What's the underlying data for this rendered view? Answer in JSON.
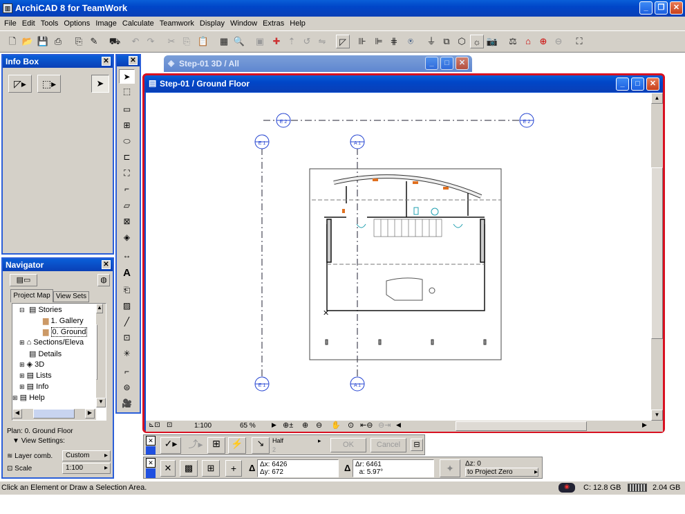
{
  "app": {
    "title": "ArchiCAD 8 for TeamWork"
  },
  "menu": [
    "File",
    "Edit",
    "Tools",
    "Options",
    "Image",
    "Calculate",
    "Teamwork",
    "Display",
    "Window",
    "Extras",
    "Help"
  ],
  "infobox": {
    "title": "Info Box"
  },
  "navigator": {
    "title": "Navigator",
    "tab_project": "Project Map",
    "tab_views": "View Sets",
    "tree": {
      "stories": "Stories",
      "gallery": "1. Gallery",
      "ground": "0. Ground",
      "sections": "Sections/Eleva",
      "details": "Details",
      "three_d": "3D",
      "lists": "Lists",
      "info": "Info",
      "help": "Help"
    },
    "plan": "Plan: 0. Ground Floor",
    "view_settings": "View Settings:",
    "layer_label": "Layer comb.",
    "layer_value": "Custom",
    "scale_label": "Scale",
    "scale_value": "1:100"
  },
  "window3d": {
    "title": "Step-01 3D / All"
  },
  "plan_window": {
    "title": "Step-01 / Ground Floor",
    "scale": "1:100",
    "zoom": "65 %"
  },
  "grid_markers": {
    "e2": "E 2",
    "e1": "E 1",
    "a1": "A 1"
  },
  "control_box": {
    "half_label": "Half",
    "half_sub": "2",
    "ok": "OK",
    "cancel": "Cancel"
  },
  "coords": {
    "dx_label": "Δx:",
    "dx": "6426",
    "dy_label": "Δy:",
    "dy": "672",
    "dr_label": "Δr:",
    "dr": "6461",
    "da_label": "a:",
    "da": "5.97°",
    "dz_label": "Δz:",
    "dz": "0",
    "ref": "to Project Zero"
  },
  "status": {
    "message": "Click an Element or Draw a Selection Area.",
    "disk": "C: 12.8 GB",
    "memory": "2.04 GB"
  }
}
